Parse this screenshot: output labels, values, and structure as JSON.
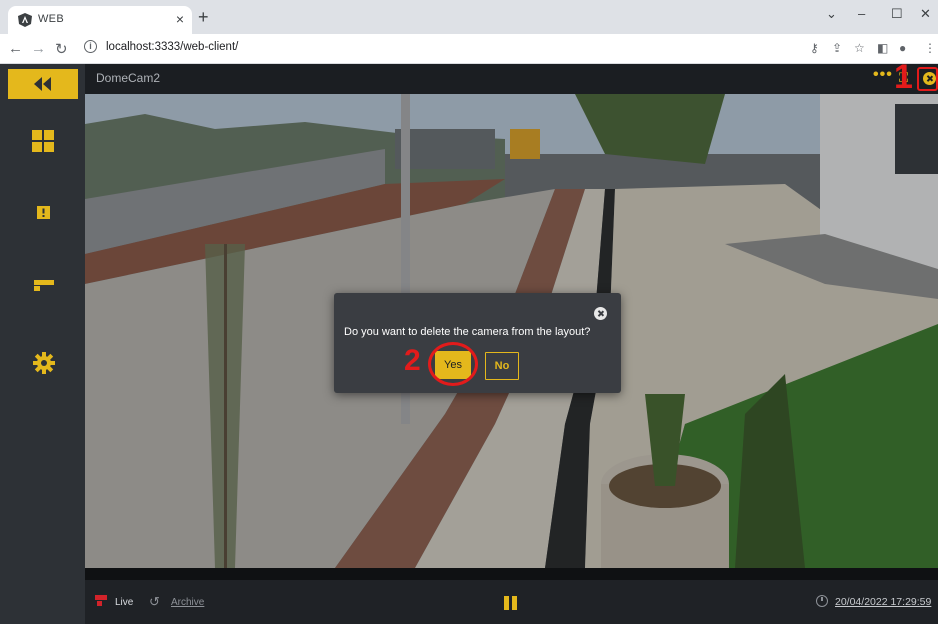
{
  "browser": {
    "tab_title": "WEB",
    "tab_close": "×",
    "new_tab": "+",
    "url": "localhost:3333/web-client/",
    "window_controls": {
      "chevron": "⌄",
      "minimize": "–",
      "maximize": "☐",
      "close": "✕"
    }
  },
  "sidebar": {
    "items": [
      {
        "name": "collapse",
        "icon": "double-chevron-left-icon"
      },
      {
        "name": "layouts",
        "icon": "grid-icon"
      },
      {
        "name": "alerts",
        "icon": "alert-icon"
      },
      {
        "name": "cameras",
        "icon": "camera-icon"
      },
      {
        "name": "settings",
        "icon": "gear-icon"
      }
    ]
  },
  "camera": {
    "name": "DomeCam2",
    "more": "•••",
    "fullscreen": "⛶"
  },
  "dialog": {
    "message": "Do you want to delete the camera from the layout?",
    "yes_label": "Yes",
    "no_label": "No"
  },
  "footer": {
    "live_label": "Live",
    "archive_label": "Archive",
    "timestamp": "20/04/2022 17:29:59"
  },
  "annotations": {
    "step1": "1",
    "step2": "2"
  },
  "colors": {
    "accent": "#e4b81c",
    "annotation": "#e21b1b",
    "sidebar": "#2d3136"
  }
}
